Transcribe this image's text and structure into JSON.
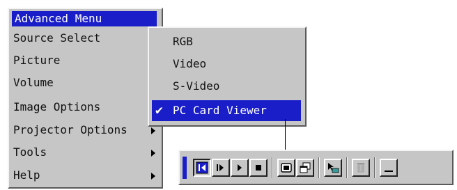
{
  "main_menu": {
    "title": "Advanced Menu",
    "items": [
      {
        "label": "Source Select",
        "has_submenu": true
      },
      {
        "label": "Picture",
        "has_submenu": false
      },
      {
        "label": "Volume",
        "has_submenu": false
      },
      {
        "label": "Image Options",
        "has_submenu": true
      },
      {
        "label": "Projector Options",
        "has_submenu": true
      },
      {
        "label": "Tools",
        "has_submenu": true
      },
      {
        "label": "Help",
        "has_submenu": true
      }
    ]
  },
  "source_submenu": {
    "items": [
      {
        "label": "RGB",
        "checked": false
      },
      {
        "label": "Video",
        "checked": false
      },
      {
        "label": "S-Video",
        "checked": false
      },
      {
        "label": "PC Card Viewer",
        "checked": true
      }
    ],
    "check_glyph": "✔"
  },
  "toolbar": {
    "buttons": [
      {
        "icon": "previous-slide-icon",
        "pressed": true
      },
      {
        "icon": "next-slide-icon",
        "pressed": false
      },
      {
        "icon": "play-icon",
        "pressed": false
      },
      {
        "icon": "stop-icon",
        "pressed": false
      },
      {
        "icon": "screen-icon",
        "pressed": false
      },
      {
        "icon": "windows-icon",
        "pressed": false
      },
      {
        "icon": "select-folder-icon",
        "pressed": false
      },
      {
        "icon": "delete-disabled-icon",
        "pressed": false
      },
      {
        "icon": "minimize-icon",
        "pressed": false
      }
    ]
  },
  "colors": {
    "highlight": "#1a1ec8",
    "panel": "#c6c6c6"
  }
}
